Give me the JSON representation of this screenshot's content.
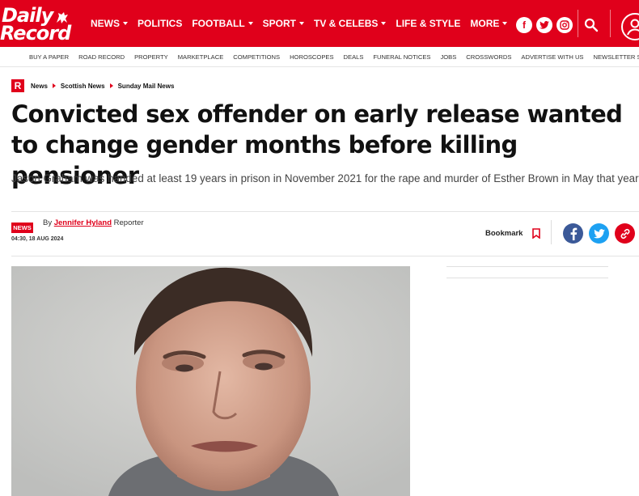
{
  "brand": {
    "line1": "Daily",
    "line2": "Record",
    "color": "#e0001b"
  },
  "nav": [
    {
      "label": "NEWS",
      "dropdown": true
    },
    {
      "label": "POLITICS",
      "dropdown": false
    },
    {
      "label": "FOOTBALL",
      "dropdown": true
    },
    {
      "label": "SPORT",
      "dropdown": true
    },
    {
      "label": "TV & CELEBS",
      "dropdown": true
    },
    {
      "label": "LIFE & STYLE",
      "dropdown": false
    },
    {
      "label": "MORE",
      "dropdown": true
    }
  ],
  "social_header": [
    "facebook-icon",
    "twitter-icon",
    "instagram-icon"
  ],
  "subnav": [
    "BUY A PAPER",
    "ROAD RECORD",
    "PROPERTY",
    "MARKETPLACE",
    "COMPETITIONS",
    "HOROSCOPES",
    "DEALS",
    "FUNERAL NOTICES",
    "JOBS",
    "CROSSWORDS",
    "ADVERTISE WITH US",
    "NEWSLETTER SIGNUP"
  ],
  "breadcrumbs": [
    "News",
    "Scottish News",
    "Sunday Mail News"
  ],
  "article": {
    "headline": "Convicted sex offender on early release wanted to change gender months before killing pensioner",
    "standfirst": "Jason Graham was handed at least 19 years in prison in November 2021 for the rape and murder of Esther Brown in May that year",
    "section_badge": "NEWS",
    "byline_prefix": "By",
    "author": "Jennifer Hyland",
    "author_role": "Reporter",
    "timestamp": "04:30, 18 AUG 2024",
    "bookmark_label": "Bookmark"
  },
  "share": [
    {
      "icon": "facebook-icon",
      "color": "#3b5998"
    },
    {
      "icon": "twitter-icon",
      "color": "#1da1f2"
    },
    {
      "icon": "link-icon",
      "color": "#e0001b"
    }
  ]
}
